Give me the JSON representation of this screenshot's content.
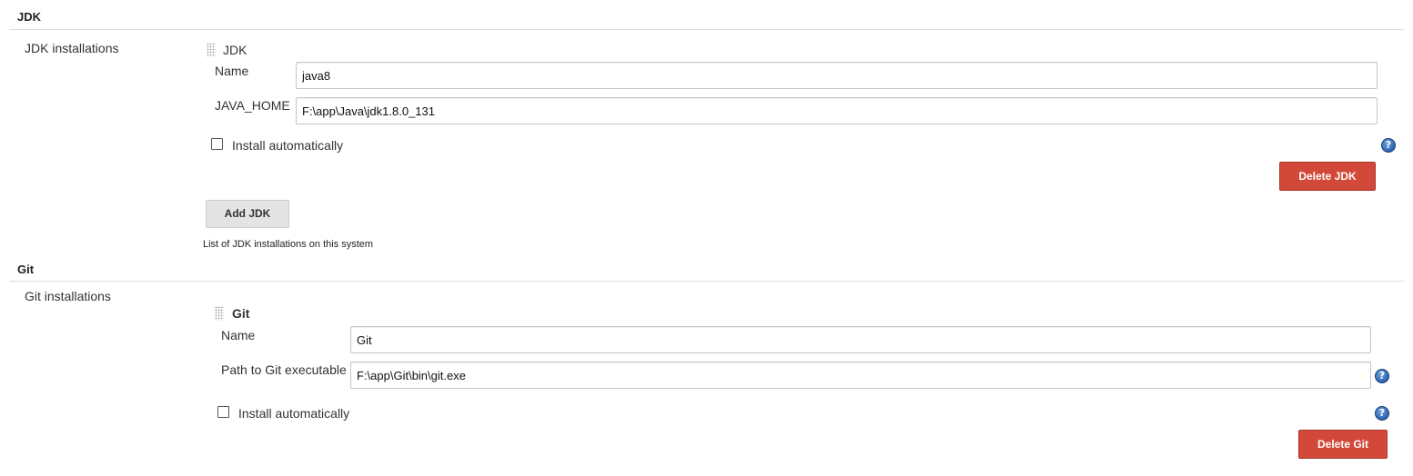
{
  "jdk_section": {
    "title": "JDK",
    "installations_label": "JDK installations",
    "item": {
      "header": "JDK",
      "name_label": "Name",
      "name_value": "java8",
      "home_label": "JAVA_HOME",
      "home_value": "F:\\app\\Java\\jdk1.8.0_131",
      "install_auto_label": "Install automatically",
      "install_auto_checked": false,
      "delete_label": "Delete JDK"
    },
    "add_label": "Add JDK",
    "description": "List of JDK installations on this system"
  },
  "git_section": {
    "title": "Git",
    "installations_label": "Git installations",
    "item": {
      "header": "Git",
      "name_label": "Name",
      "name_value": "Git",
      "path_label": "Path to Git executable",
      "path_value": "F:\\app\\Git\\bin\\git.exe",
      "install_auto_label": "Install automatically",
      "install_auto_checked": false,
      "delete_label": "Delete Git"
    }
  },
  "icons": {
    "help": "help-icon",
    "drag": "drag-handle-icon"
  },
  "colors": {
    "danger_button": "#d24939",
    "help_icon": "#2c64b4",
    "rule": "#dddddd"
  }
}
